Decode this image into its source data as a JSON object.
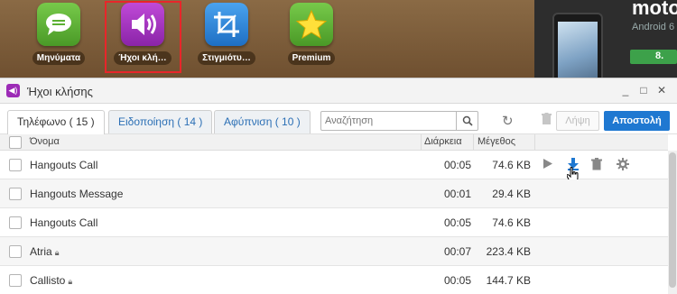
{
  "launcher": {
    "apps": [
      {
        "label": "Μηνύματα",
        "icon": "messages-icon",
        "color": "#5cb032"
      },
      {
        "label": "Ήχοι κλή…",
        "icon": "speaker-icon",
        "color": "#a331c4"
      },
      {
        "label": "Στιγμιότυ…",
        "icon": "crop-icon",
        "color": "#2e8de0"
      },
      {
        "label": "Premium",
        "icon": "star-icon",
        "color": "#5cb032"
      }
    ]
  },
  "promo": {
    "brand": "moto",
    "sub": "Android 6",
    "button": "8."
  },
  "window": {
    "title": "Ήχοι κλήσης",
    "controls": {
      "minimize": "_",
      "maximize": "□",
      "close": "✕"
    }
  },
  "tabs": [
    {
      "label": "Τηλέφωνο ( 15 )",
      "active": true
    },
    {
      "label": "Ειδοποίηση ( 14 )",
      "active": false
    },
    {
      "label": "Αφύπνιση ( 10 )",
      "active": false
    }
  ],
  "search": {
    "placeholder": "Αναζήτηση",
    "value": ""
  },
  "toolbar": {
    "get_label": "Λήψη",
    "send_label": "Αποστολή"
  },
  "table": {
    "headers": {
      "name": "Όνομα",
      "duration": "Διάρκεια",
      "size": "Μέγεθος"
    },
    "rows": [
      {
        "name": "Hangouts Call",
        "locked": false,
        "duration": "00:05",
        "size": "74.6 KB"
      },
      {
        "name": "Hangouts Message",
        "locked": false,
        "duration": "00:01",
        "size": "29.4 KB"
      },
      {
        "name": "Hangouts Call",
        "locked": false,
        "duration": "00:05",
        "size": "74.6 KB"
      },
      {
        "name": "Atria",
        "locked": true,
        "duration": "00:07",
        "size": "223.4 KB"
      },
      {
        "name": "Callisto",
        "locked": true,
        "duration": "00:05",
        "size": "144.7 KB"
      }
    ]
  },
  "colors": {
    "accent": "#1f78d1",
    "selection": "#e8262a"
  }
}
